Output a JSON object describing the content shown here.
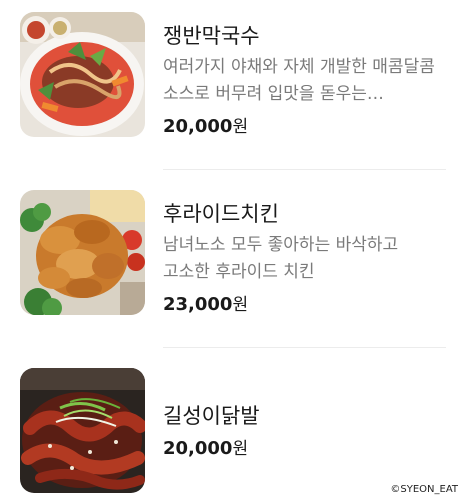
{
  "menu": {
    "items": [
      {
        "name": "쟁반막국수",
        "description": "여러가지 야채와 자체 개발한 매콤달콤 소스로 버무려 입맛을 돋우는 쟁반막국수",
        "price": "20,000",
        "currency": "원"
      },
      {
        "name": "후라이드치킨",
        "description": "남녀노소 모두 좋아하는 바삭하고 고소한 후라이드 치킨",
        "price": "23,000",
        "currency": "원"
      },
      {
        "name": "길성이닭발",
        "price": "20,000",
        "currency": "원"
      }
    ]
  },
  "watermark": "©SYEON_EAT"
}
